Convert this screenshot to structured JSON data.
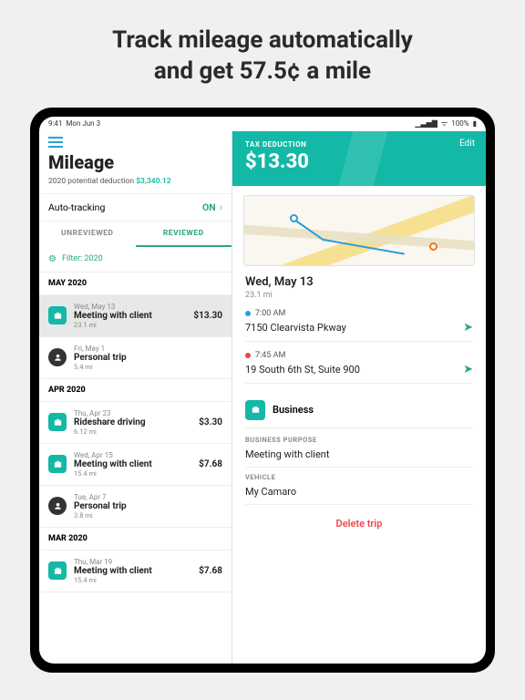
{
  "headline": {
    "l1": "Track mileage automatically",
    "l2": "and get 57.5¢ a mile"
  },
  "statusbar": {
    "time": "9:41",
    "date": "Mon Jun 3",
    "battery": "100%"
  },
  "left": {
    "title": "Mileage",
    "subtitle_pre": "2020 potential deduction ",
    "subtitle_amt": "$3,340.12",
    "autotrack_label": "Auto-tracking",
    "autotrack_state": "ON",
    "tabs": {
      "unreviewed": "UNREVIEWED",
      "reviewed": "REVIEWED"
    },
    "filter": "Filter: 2020",
    "months": [
      {
        "label": "MAY 2020",
        "trips": [
          {
            "date": "Wed, May 13",
            "name": "Meeting with client",
            "dist": "23.1 mi",
            "amt": "$13.30",
            "type": "biz",
            "sel": true
          },
          {
            "date": "Fri, May 1",
            "name": "Personal trip",
            "dist": "5.4 mi",
            "amt": "",
            "type": "pers",
            "sel": false
          }
        ]
      },
      {
        "label": "APR 2020",
        "trips": [
          {
            "date": "Thu, Apr 23",
            "name": "Rideshare driving",
            "dist": "6.12 mi",
            "amt": "$3.30",
            "type": "biz",
            "sel": false
          },
          {
            "date": "Wed, Apr 15",
            "name": "Meeting with client",
            "dist": "15.4 mi",
            "amt": "$7.68",
            "type": "biz",
            "sel": false
          },
          {
            "date": "Tue, Apr 7",
            "name": "Personal trip",
            "dist": "3.8 mi",
            "amt": "",
            "type": "pers",
            "sel": false
          }
        ]
      },
      {
        "label": "MAR 2020",
        "trips": [
          {
            "date": "Thu, Mar 19",
            "name": "Meeting with client",
            "dist": "15.4 mi",
            "amt": "$7.68",
            "type": "biz",
            "sel": false
          }
        ]
      }
    ]
  },
  "detail": {
    "edit": "Edit",
    "deduct_lbl": "TAX DEDUCTION",
    "deduct_amt": "$13.30",
    "date": "Wed, May 13",
    "dist": "23.1 mi",
    "stops": [
      {
        "time": "7:00 AM",
        "addr": "7150 Clearvista Pkway",
        "color": "blue"
      },
      {
        "time": "7:45 AM",
        "addr": "19 South 6th St, Suite 900",
        "color": "red"
      }
    ],
    "cat": "Business",
    "purpose_lbl": "BUSINESS PURPOSE",
    "purpose_val": "Meeting with client",
    "vehicle_lbl": "VEHICLE",
    "vehicle_val": "My Camaro",
    "delete": "Delete trip"
  }
}
